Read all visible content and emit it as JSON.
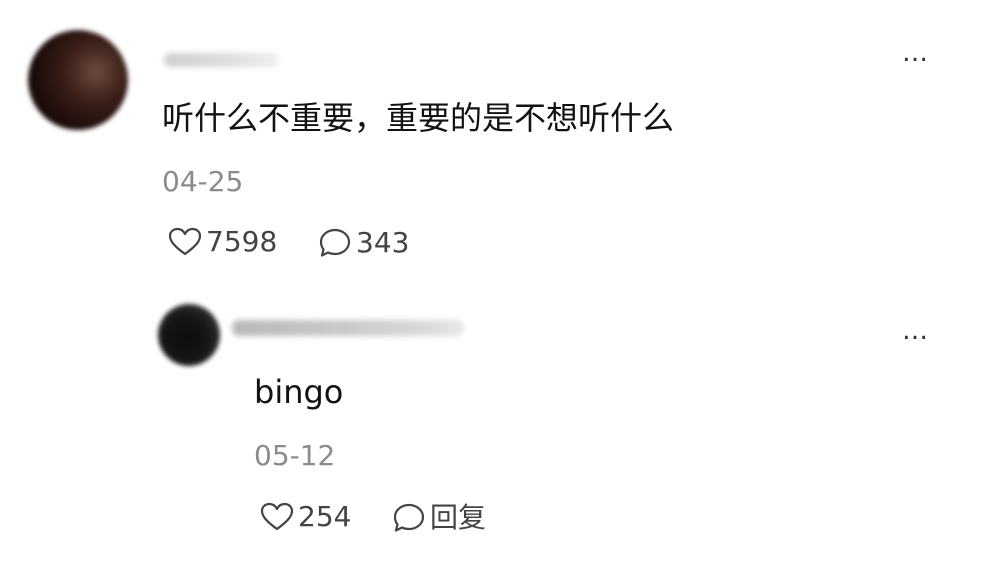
{
  "comment": {
    "text": "听什么不重要，重要的是不想听什么",
    "date": "04-25",
    "likes": "7598",
    "replies": "343",
    "more_label": "…"
  },
  "reply": {
    "text": "bingo",
    "date": "05-12",
    "likes": "254",
    "reply_label": "回复",
    "more_label": "…"
  },
  "icons": {
    "like": "heart-outline-icon",
    "comment": "speech-bubble-outline-icon",
    "more": "ellipsis-icon"
  }
}
